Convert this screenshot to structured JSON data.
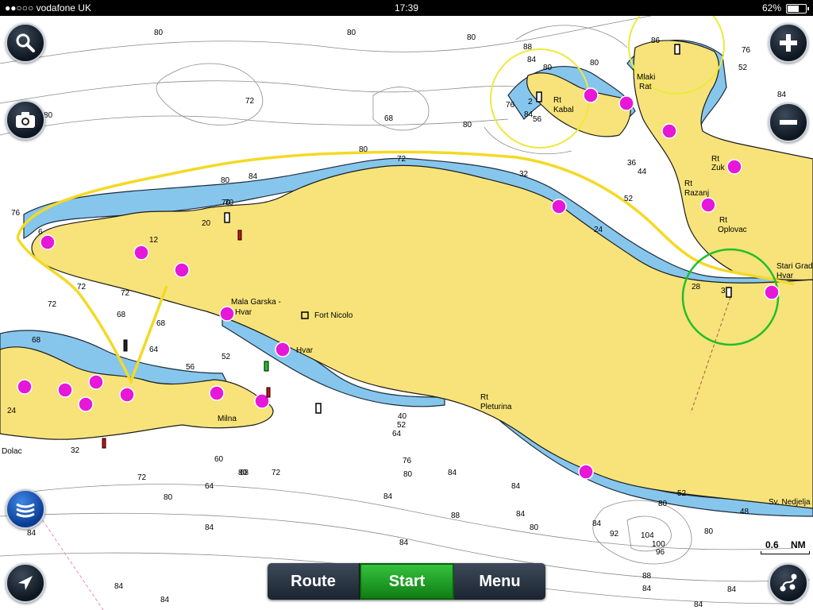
{
  "status_bar": {
    "carrier": "●●○○○ vodafone UK",
    "time": "17:39",
    "battery": "62%"
  },
  "colors": {
    "land": "#f7e379",
    "shallow": "#86c6ec",
    "route": "#f4d926",
    "circle_yellow": "#ecea3a",
    "circle_green": "#1fbf2a",
    "marina": "#e617d8",
    "toolbar": "#1b2430",
    "start": "#1f9a25"
  },
  "controls": {
    "search_icon": "magnifier-icon",
    "camera_icon": "camera-icon",
    "sonar_icon": "sonar-icon",
    "locate_icon": "navigation-arrow-icon",
    "zoom_in_icon": "plus-icon",
    "zoom_out_icon": "minus-icon",
    "route_tools_icon": "route-points-icon"
  },
  "toolbar": {
    "route": "Route",
    "start": "Start",
    "menu": "Menu"
  },
  "scale": {
    "value": "0.6",
    "unit": "NM"
  },
  "places": {
    "rt_kabal_1": "Rt",
    "rt_kabal_2": "Kabal",
    "mlaki_1": "Mlaki",
    "mlaki_2": "Rat",
    "zuk_1": "Rt",
    "zuk_2": "Zuk",
    "razanj_1": "Rt",
    "razanj_2": "Razanj",
    "oplovac_1": "Rt",
    "oplovac_2": "Oplovac",
    "stari_1": "Stari Grad",
    "stari_2": "Hvar",
    "mala_1": "Mala Garska -",
    "mala_2": "Hvar",
    "fort": "Fort Nicolo",
    "hvar": "Hvar",
    "pleturina_1": "Rt",
    "pleturina_2": "Pleturina",
    "nedjelja": "Sv. Nedjelja",
    "milna": "Milna",
    "dolac": "Dolac"
  },
  "depths": [
    "80",
    "80",
    "80",
    "88",
    "84",
    "80",
    "80",
    "86",
    "76",
    "52",
    "72",
    "68",
    "80",
    "76",
    "84",
    "56",
    "2",
    "84",
    "80",
    "80",
    "72",
    "52",
    "36",
    "44",
    "76",
    "6",
    "20",
    "12",
    "70",
    "32",
    "24",
    "28",
    "3",
    "80",
    "84",
    "68",
    "72",
    "72",
    "72",
    "68",
    "68",
    "64",
    "56",
    "52",
    "24",
    "40",
    "52",
    "64",
    "76",
    "80",
    "84",
    "84",
    "84",
    "80",
    "72",
    "60",
    "64",
    "68",
    "72",
    "80",
    "84",
    "84",
    "88",
    "84",
    "80",
    "84",
    "92",
    "104",
    "100",
    "96",
    "88",
    "84",
    "80",
    "48",
    "52",
    "80",
    "84",
    "84",
    "84",
    "84",
    "84",
    "70",
    "32"
  ]
}
